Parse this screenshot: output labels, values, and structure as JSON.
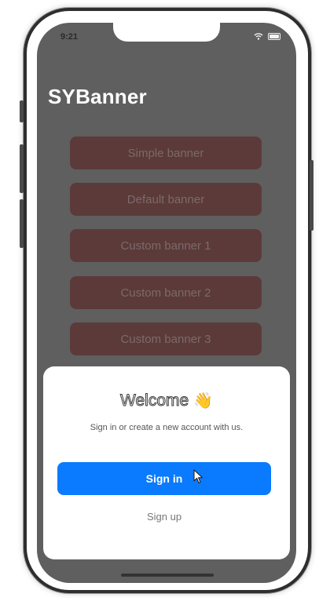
{
  "status_bar": {
    "time": "9:21"
  },
  "app": {
    "title": "SYBanner"
  },
  "banner_buttons": [
    {
      "label": "Simple banner"
    },
    {
      "label": "Default banner"
    },
    {
      "label": "Custom banner 1"
    },
    {
      "label": "Custom banner 2"
    },
    {
      "label": "Custom banner 3"
    }
  ],
  "sheet": {
    "title": "Welcome",
    "emoji": "👋",
    "subtitle": "Sign in or create a new account with us.",
    "signin_label": "Sign in",
    "signup_label": "Sign up"
  },
  "colors": {
    "accent": "#0a7aff",
    "banner_button_bg": "#5c3a3a",
    "dim_overlay": "#5f5f5f"
  }
}
